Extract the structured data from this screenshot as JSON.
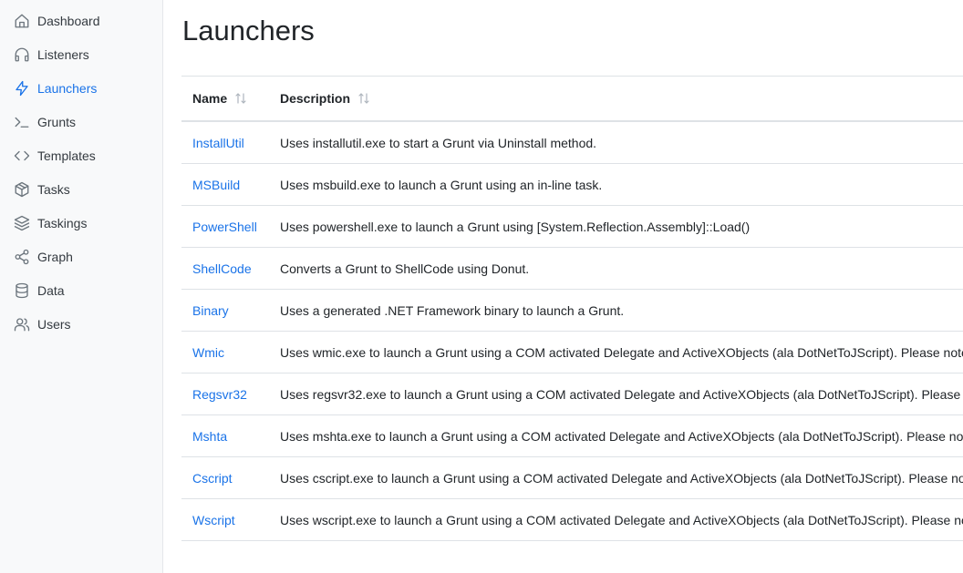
{
  "sidebar": {
    "items": [
      {
        "label": "Dashboard",
        "icon": "home-icon"
      },
      {
        "label": "Listeners",
        "icon": "headphones-icon"
      },
      {
        "label": "Launchers",
        "icon": "lightning-icon",
        "active": true
      },
      {
        "label": "Grunts",
        "icon": "terminal-icon"
      },
      {
        "label": "Templates",
        "icon": "code-icon"
      },
      {
        "label": "Tasks",
        "icon": "box-icon"
      },
      {
        "label": "Taskings",
        "icon": "layers-icon"
      },
      {
        "label": "Graph",
        "icon": "share-icon"
      },
      {
        "label": "Data",
        "icon": "database-icon"
      },
      {
        "label": "Users",
        "icon": "users-icon"
      }
    ]
  },
  "main": {
    "title": "Launchers",
    "table": {
      "columns": [
        "Name",
        "Description"
      ],
      "rows": [
        {
          "name": "InstallUtil",
          "description": "Uses installutil.exe to start a Grunt via Uninstall method."
        },
        {
          "name": "MSBuild",
          "description": "Uses msbuild.exe to launch a Grunt using an in-line task."
        },
        {
          "name": "PowerShell",
          "description": "Uses powershell.exe to launch a Grunt using [System.Reflection.Assembly]::Load()"
        },
        {
          "name": "ShellCode",
          "description": "Converts a Grunt to ShellCode using Donut."
        },
        {
          "name": "Binary",
          "description": "Uses a generated .NET Framework binary to launch a Grunt."
        },
        {
          "name": "Wmic",
          "description": "Uses wmic.exe to launch a Grunt using a COM activated Delegate and ActiveXObjects (ala DotNetToJScript). Please note th"
        },
        {
          "name": "Regsvr32",
          "description": "Uses regsvr32.exe to launch a Grunt using a COM activated Delegate and ActiveXObjects (ala DotNetToJScript). Please not"
        },
        {
          "name": "Mshta",
          "description": "Uses mshta.exe to launch a Grunt using a COM activated Delegate and ActiveXObjects (ala DotNetToJScript). Please note t"
        },
        {
          "name": "Cscript",
          "description": "Uses cscript.exe to launch a Grunt using a COM activated Delegate and ActiveXObjects (ala DotNetToJScript). Please note"
        },
        {
          "name": "Wscript",
          "description": "Uses wscript.exe to launch a Grunt using a COM activated Delegate and ActiveXObjects (ala DotNetToJScript). Please note"
        }
      ]
    }
  },
  "colors": {
    "accent": "#1a73e8",
    "sidebar_bg": "#f8f9fa",
    "border": "#dee2e6",
    "icon": "#6c757d"
  }
}
